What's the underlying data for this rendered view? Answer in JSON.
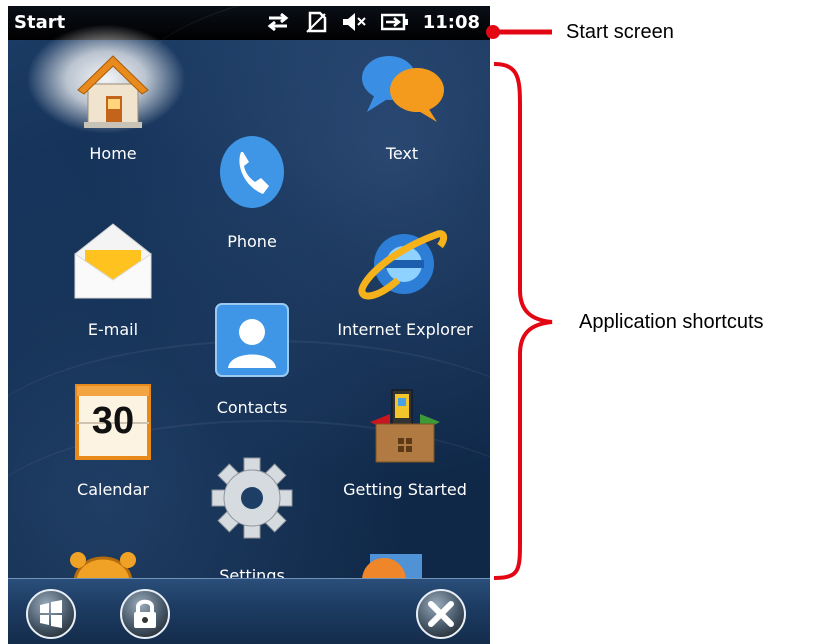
{
  "status_bar": {
    "title": "Start",
    "time": "11:08",
    "icons": [
      "sync-arrows-icon",
      "no-sim-icon",
      "muted-speaker-icon",
      "battery-charging-icon"
    ]
  },
  "tiles": [
    {
      "label": "Home",
      "icon": "home-icon"
    },
    {
      "label": "Text",
      "icon": "chat-bubbles-icon"
    },
    {
      "label": "Phone",
      "icon": "phone-icon"
    },
    {
      "label": "E-mail",
      "icon": "envelope-icon"
    },
    {
      "label": "Internet Explorer",
      "icon": "internet-explorer-icon"
    },
    {
      "label": "Contacts",
      "icon": "contact-card-icon"
    },
    {
      "label": "Calendar",
      "icon": "calendar-icon",
      "date": "30"
    },
    {
      "label": "Getting Started",
      "icon": "gift-box-icon"
    },
    {
      "label": "Settings",
      "icon": "gear-icon"
    }
  ],
  "bottom_bar": {
    "buttons": [
      "windows-start-icon",
      "lock-icon",
      "close-icon"
    ]
  },
  "annotations": {
    "status_bar": "Start screen",
    "tiles": "Application shortcuts"
  },
  "colors": {
    "annotation": "#e30613",
    "screen_bg": "#0f2747"
  }
}
